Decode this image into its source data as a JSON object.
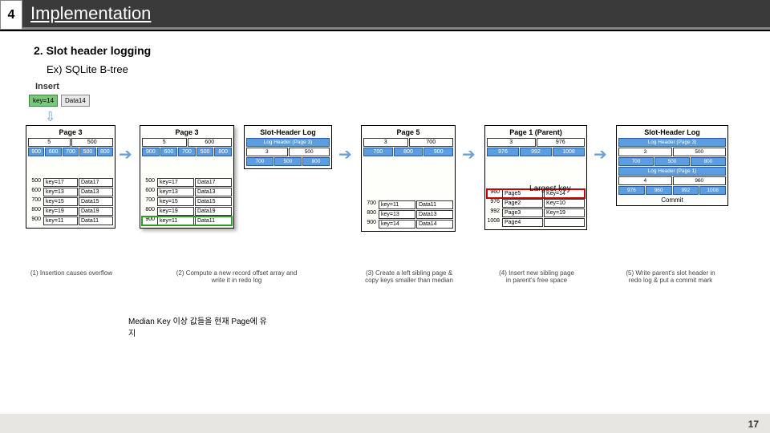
{
  "header": {
    "num": "4",
    "title": "Implementation"
  },
  "sub1": "2.  Slot header logging",
  "sub2": "Ex) SQLite B-tree",
  "insert": {
    "label": "Insert",
    "key": "key=14",
    "data": "Data14"
  },
  "p3a": {
    "title": "Page 3",
    "hdr": [
      "5",
      "500"
    ],
    "arr": [
      "900",
      "600",
      "700",
      "500",
      "800"
    ],
    "rows": [
      {
        "o": "500",
        "k": "key=17",
        "d": "Data17"
      },
      {
        "o": "600",
        "k": "key=13",
        "d": "Data13"
      },
      {
        "o": "700",
        "k": "key=15",
        "d": "Data15"
      },
      {
        "o": "800",
        "k": "key=19",
        "d": "Data19"
      },
      {
        "o": "900",
        "k": "key=11",
        "d": "Data11"
      }
    ]
  },
  "p3b": {
    "title": "Page 3",
    "hdr": [
      "5",
      "600"
    ],
    "arr": [
      "900",
      "600",
      "700",
      "500",
      "800"
    ],
    "rows": [
      {
        "o": "500",
        "k": "key=17",
        "d": "Data17"
      },
      {
        "o": "600",
        "k": "key=13",
        "d": "Data13"
      },
      {
        "o": "700",
        "k": "key=15",
        "d": "Data15"
      },
      {
        "o": "800",
        "k": "key=19",
        "d": "Data19"
      },
      {
        "o": "900",
        "k": "key=11",
        "d": "Data11"
      }
    ]
  },
  "shl1": {
    "title": "Slot-Header Log",
    "r1": "Log Header (Page 3)",
    "r2": [
      "3",
      "500"
    ],
    "arr": [
      "700",
      "500",
      "800"
    ]
  },
  "p5": {
    "title": "Page 5",
    "hdr": [
      "3",
      "700"
    ],
    "arr": [
      "700",
      "800",
      "900"
    ],
    "rows": [
      {
        "o": "700",
        "k": "key=11",
        "d": "Data11"
      },
      {
        "o": "800",
        "k": "key=13",
        "d": "Data13"
      },
      {
        "o": "900",
        "k": "key=14",
        "d": "Data14"
      }
    ]
  },
  "p1": {
    "title": "Page 1 (Parent)",
    "hdr": [
      "3",
      "976"
    ],
    "arr": [
      "976",
      "992",
      "1008"
    ],
    "rows": [
      {
        "o": "960",
        "k": "Page5",
        "d": "Key=14"
      },
      {
        "o": "976",
        "k": "Page2",
        "d": "Key=10"
      },
      {
        "o": "992",
        "k": "Page3",
        "d": "Key=19"
      },
      {
        "o": "1008",
        "k": "Page4",
        "d": ""
      }
    ]
  },
  "shl2": {
    "title": "Slot-Header Log",
    "r1": "Log Header (Page 3)",
    "r2": [
      "3",
      "500"
    ],
    "arr3": [
      "700",
      "500",
      "800"
    ],
    "r3": "Log Header (Page 1)",
    "r4": [
      "4",
      "960"
    ],
    "arr1": [
      "976",
      "960",
      "992",
      "1008"
    ],
    "commit": "Commit"
  },
  "caps": {
    "c1": "(1) Insertion causes overflow",
    "c2": "(2) Compute a new record offset array and\nwrite it in redo log",
    "c3": "(3) Create a left sibling page &\ncopy keys smaller than median",
    "c4": "(4) Insert new sibling page\nin parent's free space",
    "c5": "(5) Write parent's slot header in\nredo log & put a commit mark"
  },
  "anno1": "Largest key",
  "anno2": "Median Key 이상 값들을 현재 Page에 유\n지",
  "pagenum": "17"
}
